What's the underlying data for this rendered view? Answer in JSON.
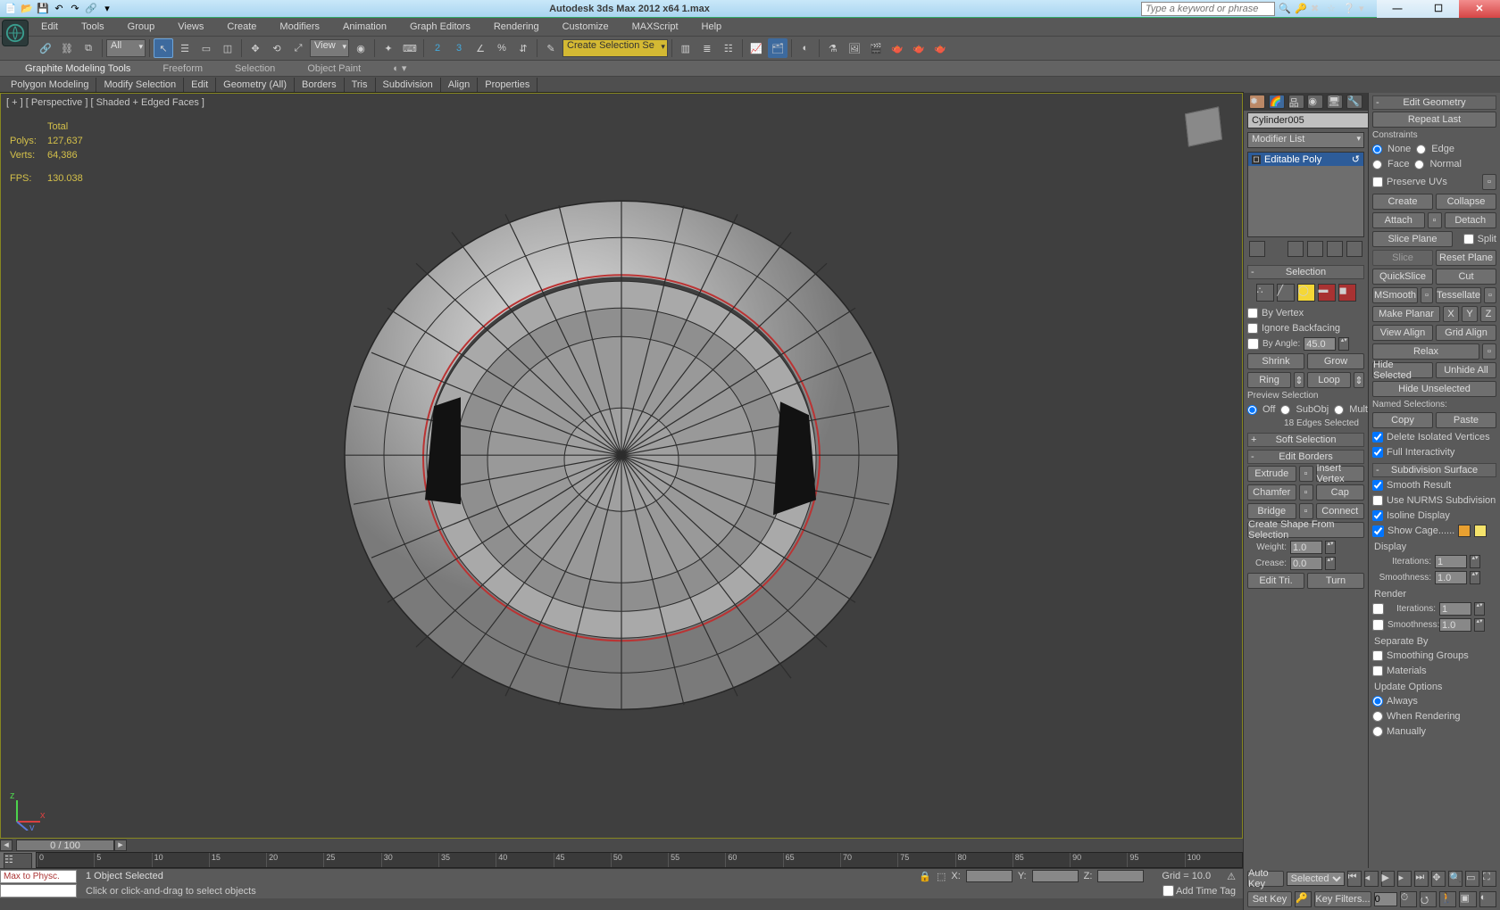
{
  "titlebar": {
    "title": "Autodesk 3ds Max 2012 x64     1.max",
    "search_placeholder": "Type a keyword or phrase"
  },
  "menubar": [
    "Edit",
    "Tools",
    "Group",
    "Views",
    "Create",
    "Modifiers",
    "Animation",
    "Graph Editors",
    "Rendering",
    "Customize",
    "MAXScript",
    "Help"
  ],
  "toolbar": {
    "set_dropdown": "All",
    "view_dropdown": "View",
    "create_sel_set": "Create Selection Se"
  },
  "ribbon_tabs": [
    "Graphite Modeling Tools",
    "Freeform",
    "Selection",
    "Object Paint"
  ],
  "ribbon_sub": [
    "Polygon Modeling",
    "Modify Selection",
    "Edit",
    "Geometry (All)",
    "Borders",
    "Tris",
    "Subdivision",
    "Align",
    "Properties"
  ],
  "viewport": {
    "label": "[ + ] [ Perspective ] [ Shaded + Edged Faces ]",
    "stats": {
      "total_label": "Total",
      "polys_label": "Polys:",
      "polys": "127,637",
      "verts_label": "Verts:",
      "verts": "64,386",
      "fps_label": "FPS:",
      "fps": "130.038"
    }
  },
  "cmd_panel": {
    "object_name": "Cylinder005",
    "modifier_list": "Modifier List",
    "stack_item": "Editable Poly",
    "selection": {
      "head": "Selection",
      "by_vertex": "By Vertex",
      "ignore_bf": "Ignore Backfacing",
      "by_angle": "By Angle:",
      "angle": "45.0",
      "shrink": "Shrink",
      "grow": "Grow",
      "ring": "Ring",
      "loop": "Loop",
      "preview": "Preview Selection",
      "off": "Off",
      "subobj": "SubObj",
      "multi": "Multi",
      "status": "18 Edges Selected"
    },
    "soft_sel": "Soft Selection",
    "edit_borders": {
      "head": "Edit Borders",
      "extrude": "Extrude",
      "insert_vertex": "Insert Vertex",
      "chamfer": "Chamfer",
      "cap": "Cap",
      "bridge": "Bridge",
      "connect": "Connect",
      "create_shape": "Create Shape From Selection",
      "weight": "Weight:",
      "weight_v": "1.0",
      "crease": "Crease:",
      "crease_v": "0.0",
      "edit_tri": "Edit Tri.",
      "turn": "Turn"
    }
  },
  "edit_geo": {
    "head": "Edit Geometry",
    "repeat": "Repeat Last",
    "constraints": "Constraints",
    "none": "None",
    "edge": "Edge",
    "face": "Face",
    "normal": "Normal",
    "preserve_uvs": "Preserve UVs",
    "create": "Create",
    "collapse": "Collapse",
    "attach": "Attach",
    "detach": "Detach",
    "slice_plane": "Slice Plane",
    "split": "Split",
    "slice": "Slice",
    "reset_plane": "Reset Plane",
    "quickslice": "QuickSlice",
    "cut": "Cut",
    "msmooth": "MSmooth",
    "tessellate": "Tessellate",
    "make_planar": "Make Planar",
    "x": "X",
    "y": "Y",
    "z": "Z",
    "view_align": "View Align",
    "grid_align": "Grid Align",
    "relax": "Relax",
    "hide_sel": "Hide Selected",
    "unhide": "Unhide All",
    "hide_unsel": "Hide Unselected",
    "named_sel": "Named Selections:",
    "copy": "Copy",
    "paste": "Paste",
    "del_iso": "Delete Isolated Vertices",
    "full_int": "Full Interactivity"
  },
  "subdiv": {
    "head": "Subdivision Surface",
    "smooth": "Smooth Result",
    "nurms": "Use NURMS Subdivision",
    "isoline": "Isoline Display",
    "show_cage": "Show Cage......",
    "display": "Display",
    "iterations": "Iterations:",
    "iter_v": "1",
    "smoothness": "Smoothness:",
    "smooth_v": "1.0",
    "render": "Render",
    "r_iter_v": "1",
    "r_smooth_v": "1.0",
    "sep_by": "Separate By",
    "sg": "Smoothing Groups",
    "materials": "Materials",
    "update": "Update Options",
    "always": "Always",
    "when_render": "When Rendering",
    "manually": "Manually"
  },
  "time": {
    "frame": "0 / 100",
    "ticks": [
      "0",
      "5",
      "10",
      "15",
      "20",
      "25",
      "30",
      "35",
      "40",
      "45",
      "50",
      "55",
      "60",
      "65",
      "70",
      "75",
      "80",
      "85",
      "90",
      "95",
      "100"
    ]
  },
  "status": {
    "maxphysc": "Max to Physc.",
    "selected": "1 Object Selected",
    "x": "X:",
    "y": "Y:",
    "z": "Z:",
    "grid": "Grid = 10.0",
    "hint": "Click or click-and-drag to select objects",
    "add_time": "Add Time Tag"
  },
  "anim": {
    "auto_key": "Auto Key",
    "selected": "Selected",
    "set_key": "Set Key",
    "key_filters": "Key Filters..."
  }
}
